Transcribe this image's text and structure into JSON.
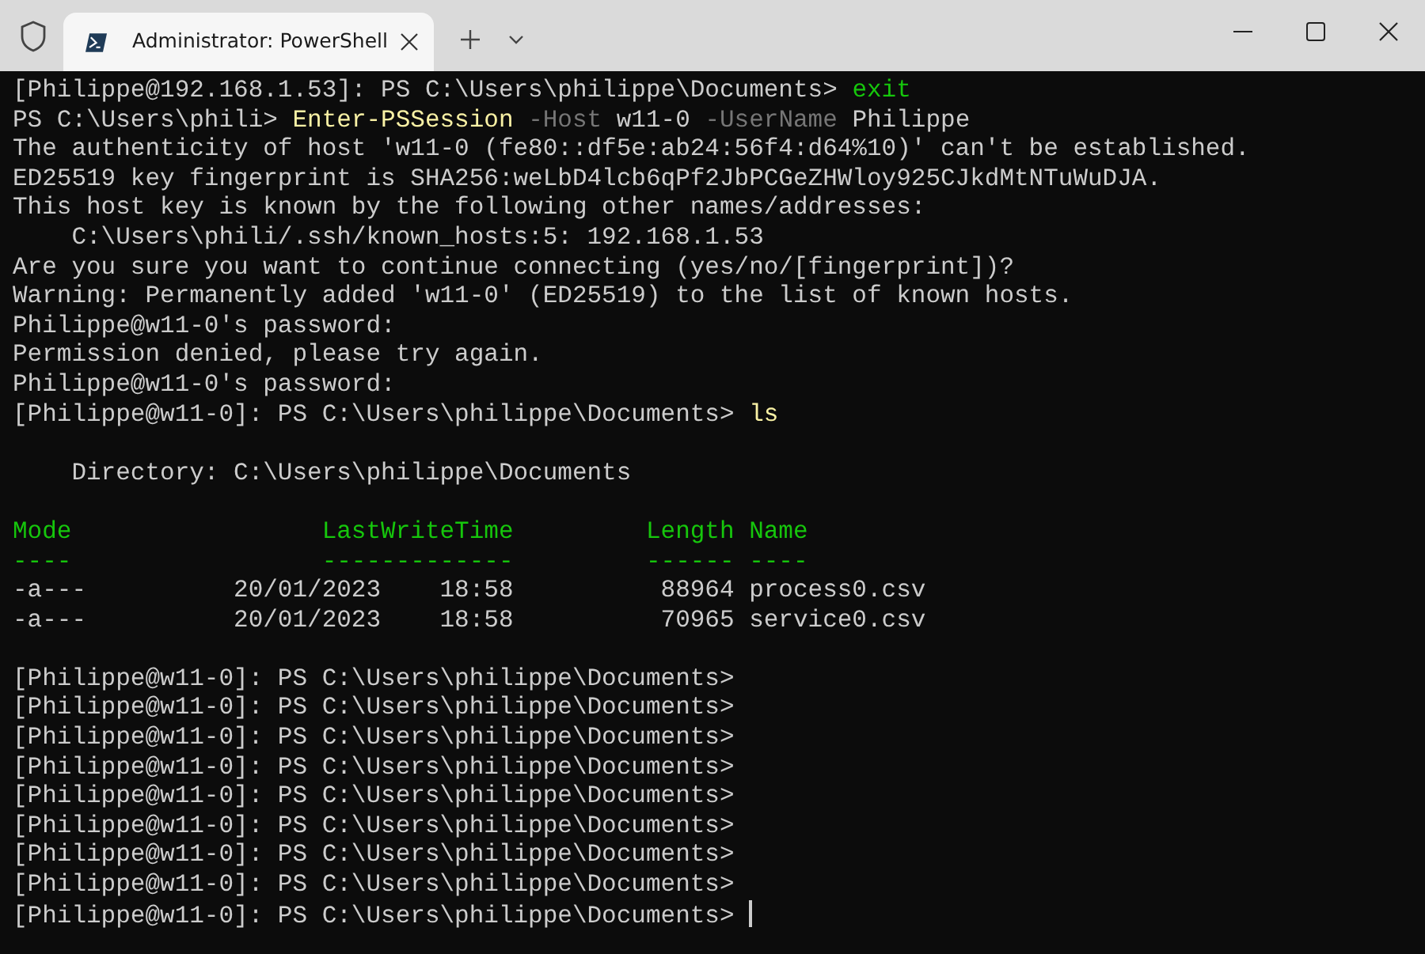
{
  "window": {
    "tabs": [
      {
        "title": "Administrator: PowerShell",
        "selected": true
      }
    ]
  },
  "terminal": {
    "cursor_visible": true,
    "lines": [
      {
        "kind": "text",
        "segments": [
          {
            "text": "[Philippe@192.168.1.53]: PS C:\\Users\\philippe\\Documents> ",
            "kind": "plain"
          },
          {
            "text": "exit",
            "kind": "keyword"
          }
        ]
      },
      {
        "kind": "text",
        "segments": [
          {
            "text": "PS C:\\Users\\phili> ",
            "kind": "plain"
          },
          {
            "text": "Enter-PSSession",
            "kind": "command"
          },
          {
            "text": " -Host",
            "kind": "parameter"
          },
          {
            "text": " w11-0",
            "kind": "plain"
          },
          {
            "text": " -UserName",
            "kind": "parameter"
          },
          {
            "text": " Philippe",
            "kind": "plain"
          }
        ]
      },
      {
        "kind": "text",
        "segments": [
          {
            "text": "The authenticity of host 'w11-0 (fe80::df5e:ab24:56f4:d64%10)' can't be established.",
            "kind": "plain"
          }
        ]
      },
      {
        "kind": "text",
        "segments": [
          {
            "text": "ED25519 key fingerprint is SHA256:weLbD4lcb6qPf2JbPCGeZHWloy925CJkdMtNTuWuDJA.",
            "kind": "plain"
          }
        ]
      },
      {
        "kind": "text",
        "segments": [
          {
            "text": "This host key is known by the following other names/addresses:",
            "kind": "plain"
          }
        ]
      },
      {
        "kind": "text",
        "segments": [
          {
            "text": "    C:\\Users\\phili/.ssh/known_hosts:5: 192.168.1.53",
            "kind": "plain"
          }
        ]
      },
      {
        "kind": "text",
        "segments": [
          {
            "text": "Are you sure you want to continue connecting (yes/no/[fingerprint])?",
            "kind": "plain"
          }
        ]
      },
      {
        "kind": "text",
        "segments": [
          {
            "text": "Warning: Permanently added 'w11-0' (ED25519) to the list of known hosts.",
            "kind": "plain"
          }
        ]
      },
      {
        "kind": "text",
        "segments": [
          {
            "text": "Philippe@w11-0's password:",
            "kind": "plain"
          }
        ]
      },
      {
        "kind": "text",
        "segments": [
          {
            "text": "Permission denied, please try again.",
            "kind": "plain"
          }
        ]
      },
      {
        "kind": "text",
        "segments": [
          {
            "text": "Philippe@w11-0's password:",
            "kind": "plain"
          }
        ]
      },
      {
        "kind": "text",
        "segments": [
          {
            "text": "[Philippe@w11-0]: PS C:\\Users\\philippe\\Documents> ",
            "kind": "plain"
          },
          {
            "text": "ls",
            "kind": "command"
          }
        ]
      },
      {
        "kind": "blank"
      },
      {
        "kind": "text",
        "segments": [
          {
            "text": "    Directory: C:\\Users\\philippe\\Documents",
            "kind": "plain"
          }
        ]
      },
      {
        "kind": "blank"
      },
      {
        "kind": "text",
        "segments": [
          {
            "text": "Mode                 LastWriteTime         Length Name",
            "kind": "header"
          }
        ]
      },
      {
        "kind": "text",
        "segments": [
          {
            "text": "----                 -------------         ------ ----",
            "kind": "header"
          }
        ]
      },
      {
        "kind": "text",
        "segments": [
          {
            "text": "-a---          20/01/2023    18:58          88964 process0.csv",
            "kind": "plain"
          }
        ]
      },
      {
        "kind": "text",
        "segments": [
          {
            "text": "-a---          20/01/2023    18:58          70965 service0.csv",
            "kind": "plain"
          }
        ]
      },
      {
        "kind": "blank"
      },
      {
        "kind": "text",
        "segments": [
          {
            "text": "[Philippe@w11-0]: PS C:\\Users\\philippe\\Documents>",
            "kind": "plain"
          }
        ]
      },
      {
        "kind": "text",
        "segments": [
          {
            "text": "[Philippe@w11-0]: PS C:\\Users\\philippe\\Documents>",
            "kind": "plain"
          }
        ]
      },
      {
        "kind": "text",
        "segments": [
          {
            "text": "[Philippe@w11-0]: PS C:\\Users\\philippe\\Documents>",
            "kind": "plain"
          }
        ]
      },
      {
        "kind": "text",
        "segments": [
          {
            "text": "[Philippe@w11-0]: PS C:\\Users\\philippe\\Documents>",
            "kind": "plain"
          }
        ]
      },
      {
        "kind": "text",
        "segments": [
          {
            "text": "[Philippe@w11-0]: PS C:\\Users\\philippe\\Documents>",
            "kind": "plain"
          }
        ]
      },
      {
        "kind": "text",
        "segments": [
          {
            "text": "[Philippe@w11-0]: PS C:\\Users\\philippe\\Documents>",
            "kind": "plain"
          }
        ]
      },
      {
        "kind": "text",
        "segments": [
          {
            "text": "[Philippe@w11-0]: PS C:\\Users\\philippe\\Documents>",
            "kind": "plain"
          }
        ]
      },
      {
        "kind": "text",
        "segments": [
          {
            "text": "[Philippe@w11-0]: PS C:\\Users\\philippe\\Documents>",
            "kind": "plain"
          }
        ]
      },
      {
        "kind": "text",
        "segments": [
          {
            "text": "[Philippe@w11-0]: PS C:\\Users\\philippe\\Documents> ",
            "kind": "plain"
          }
        ]
      }
    ]
  }
}
